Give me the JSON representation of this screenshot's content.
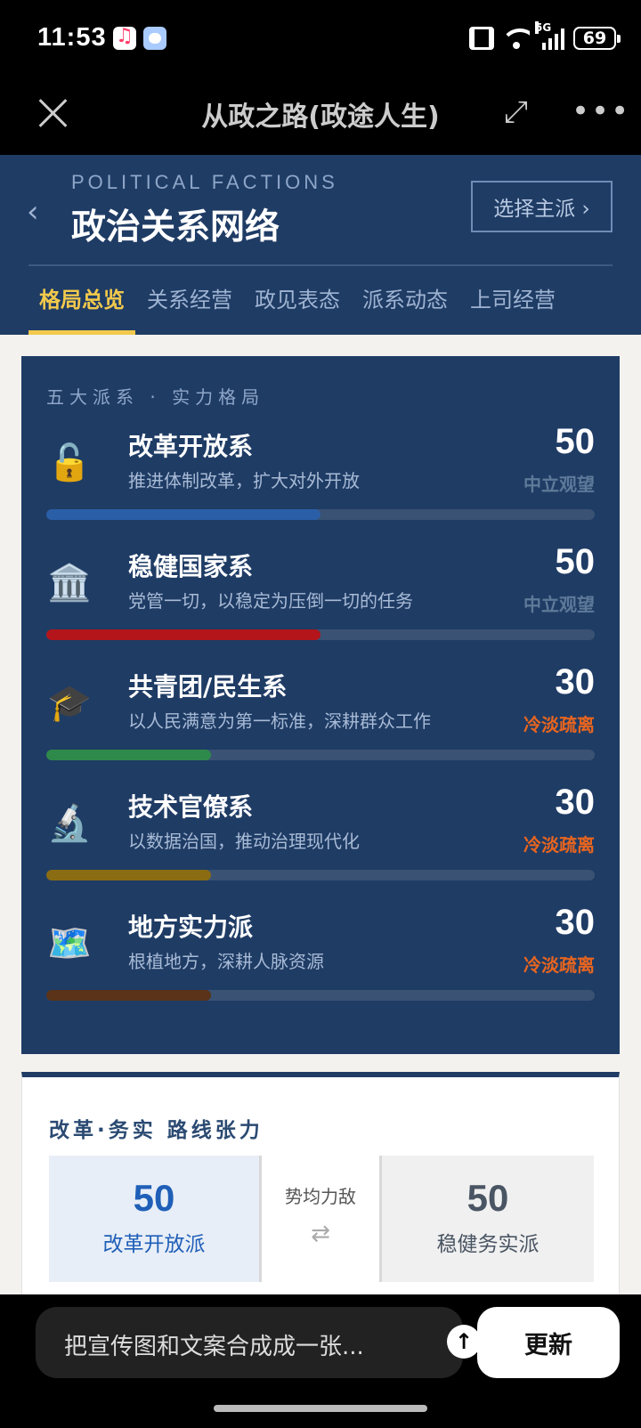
{
  "status_bar": {
    "time": "11:53",
    "network": "5G",
    "battery": "69"
  },
  "titlebar": {
    "title": "从政之路(政途人生)"
  },
  "header": {
    "eyebrow": "POLITICAL FACTIONS",
    "title": "政治关系网络",
    "select_button": "选择主派 ›"
  },
  "tabs": [
    {
      "label": "格局总览",
      "active": true
    },
    {
      "label": "关系经营",
      "active": false
    },
    {
      "label": "政见表态",
      "active": false
    },
    {
      "label": "派系动态",
      "active": false
    },
    {
      "label": "上司经营",
      "active": false
    }
  ],
  "factions_card": {
    "subtitle": "五大派系 · 实力格局",
    "factions": [
      {
        "icon": "unlocked-padlock-icon",
        "glyph": "🔓",
        "name": "改革开放系",
        "desc": "推进体制改革，扩大对外开放",
        "value": 50,
        "status": "中立观望",
        "status_color": "#5e7a99",
        "bar_color": "#2a5fa8"
      },
      {
        "icon": "classical-building-icon",
        "glyph": "🏛️",
        "name": "稳健国家系",
        "desc": "党管一切，以稳定为压倒一切的任务",
        "value": 50,
        "status": "中立观望",
        "status_color": "#5e7a99",
        "bar_color": "#b3151b"
      },
      {
        "icon": "graduation-cap-icon",
        "glyph": "🎓",
        "name": "共青团/民生系",
        "desc": "以人民满意为第一标准，深耕群众工作",
        "value": 30,
        "status": "冷淡疏离",
        "status_color": "#e8651f",
        "bar_color": "#2e8a4a"
      },
      {
        "icon": "microscope-icon",
        "glyph": "🔬",
        "name": "技术官僚系",
        "desc": "以数据治国，推动治理现代化",
        "value": 30,
        "status": "冷淡疏离",
        "status_color": "#e8651f",
        "bar_color": "#8a6c12"
      },
      {
        "icon": "world-map-icon",
        "glyph": "🗺️",
        "name": "地方实力派",
        "desc": "根植地方，深耕人脉资源",
        "value": 30,
        "status": "冷淡疏离",
        "status_color": "#e8651f",
        "bar_color": "#5a3318"
      }
    ]
  },
  "tension_card": {
    "subtitle": "改革·务实 路线张力",
    "left": {
      "value": "50",
      "label": "改革开放派",
      "color": "#1f5fb8"
    },
    "middle": {
      "label": "势均力敌",
      "icon": "swap-arrows-icon",
      "glyph": "⇄"
    },
    "right": {
      "value": "50",
      "label": "稳健务实派",
      "color": "#4a5563"
    },
    "balance_fraction": 0.5
  },
  "bottom": {
    "prompt_text": "把宣传图和文案合成成一张...",
    "update_button": "更新"
  }
}
